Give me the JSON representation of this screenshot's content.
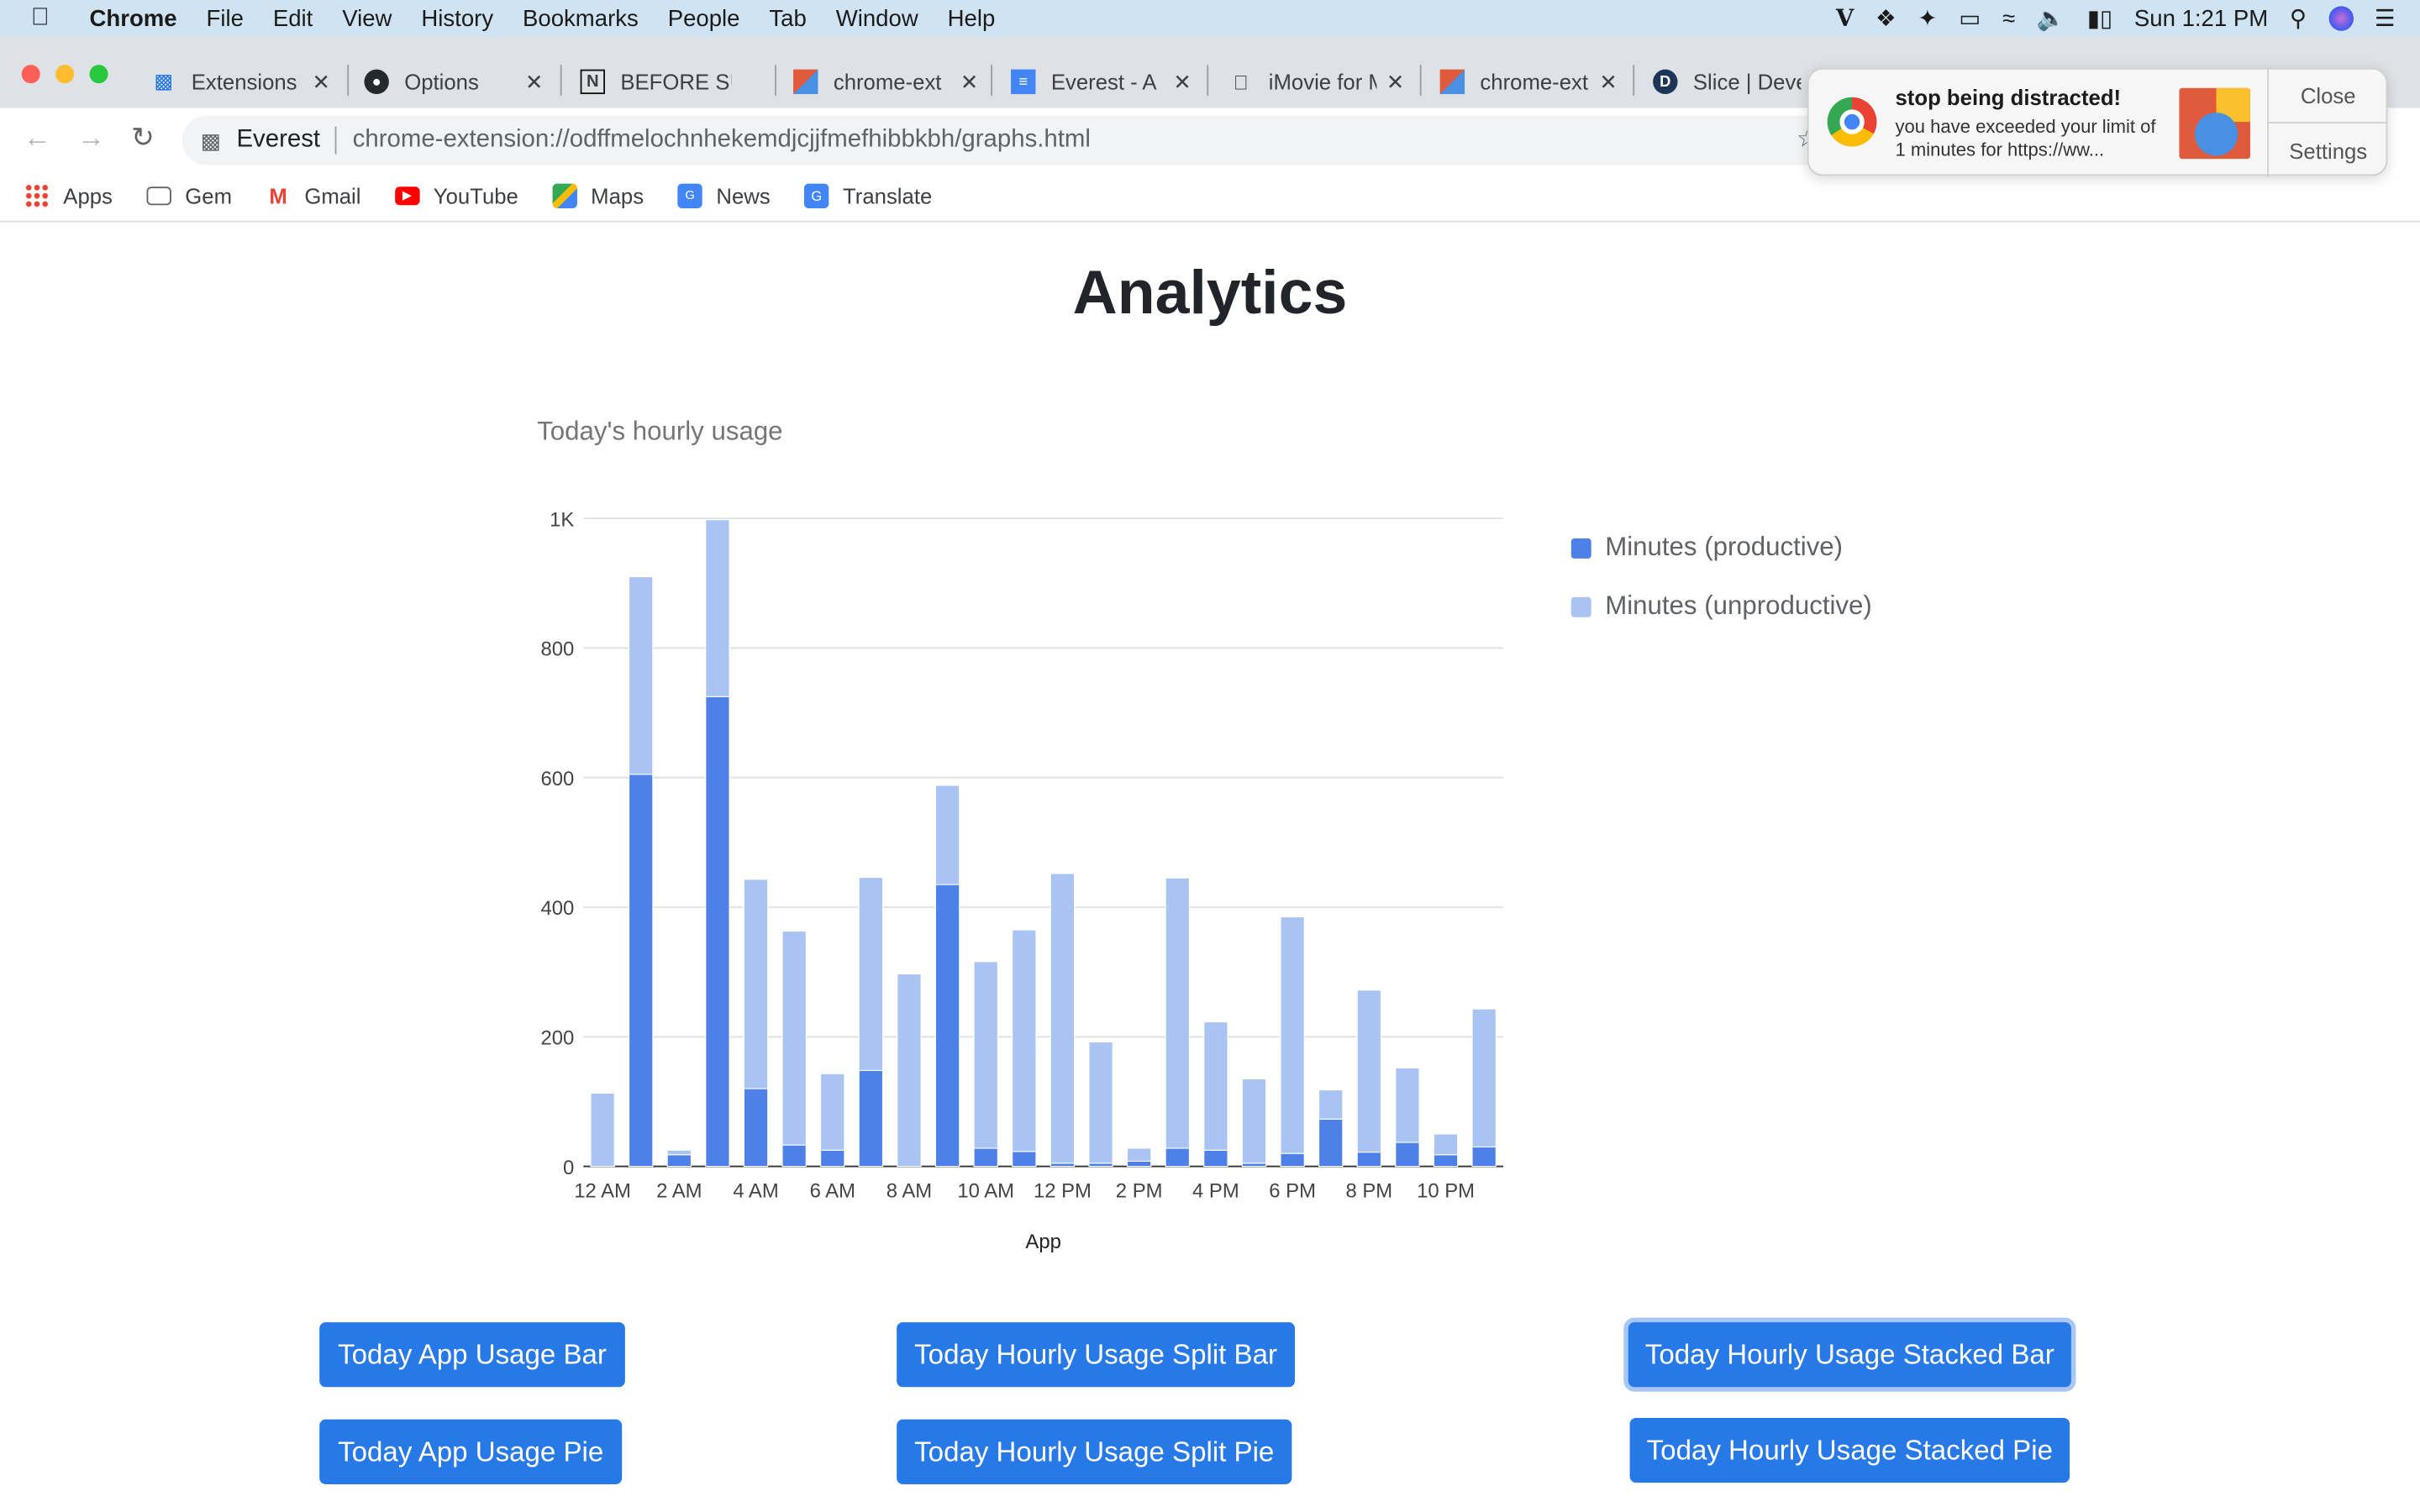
{
  "menubar": {
    "app": "Chrome",
    "items": [
      "File",
      "Edit",
      "View",
      "History",
      "Bookmarks",
      "People",
      "Tab",
      "Window",
      "Help"
    ],
    "clock": "Sun 1:21 PM"
  },
  "tabs": [
    {
      "label": "Extensions",
      "icon": "puzzle-icon"
    },
    {
      "label": "Options",
      "icon": "github-icon"
    },
    {
      "label": "BEFORE SU",
      "icon": "notion-icon"
    },
    {
      "label": "chrome-ext",
      "icon": "extension-tile-icon"
    },
    {
      "label": "Everest - A",
      "icon": "docs-icon"
    },
    {
      "label": "iMovie for M",
      "icon": "apple-icon"
    },
    {
      "label": "chrome-ext",
      "icon": "extension-tile-icon"
    },
    {
      "label": "Slice | Deve",
      "icon": "d-logo-icon"
    }
  ],
  "omnibox": {
    "site": "Everest",
    "url": "chrome-extension://odffmelochnhekemdjcjjfmefhibbkbh/graphs.html"
  },
  "bookmarks": [
    {
      "label": "Apps",
      "icon": "apps-grid-icon"
    },
    {
      "label": "Gem",
      "icon": "folder-icon"
    },
    {
      "label": "Gmail",
      "icon": "gmail-icon"
    },
    {
      "label": "YouTube",
      "icon": "youtube-icon"
    },
    {
      "label": "Maps",
      "icon": "maps-icon"
    },
    {
      "label": "News",
      "icon": "news-icon"
    },
    {
      "label": "Translate",
      "icon": "translate-icon"
    }
  ],
  "notification": {
    "title": "stop being distracted!",
    "body": "you have exceeded your limit of 1 minutes for https://ww...",
    "close_label": "Close",
    "settings_label": "Settings"
  },
  "page": {
    "title": "Analytics"
  },
  "chart_data": {
    "type": "bar",
    "stacked": true,
    "title": "Today's hourly usage",
    "xlabel": "App",
    "ylabel": "",
    "ylim": [
      0,
      1000
    ],
    "yticks": [
      0,
      200,
      400,
      600,
      800,
      1000
    ],
    "ytick_labels": [
      "0",
      "200",
      "400",
      "600",
      "800",
      "1K"
    ],
    "xtick_labels": [
      "12 AM",
      "2 AM",
      "4 AM",
      "6 AM",
      "8 AM",
      "10 AM",
      "12 PM",
      "2 PM",
      "4 PM",
      "6 PM",
      "8 PM",
      "10 PM"
    ],
    "categories": [
      "12 AM",
      "1 AM",
      "2 AM",
      "3 AM",
      "4 AM",
      "5 AM",
      "6 AM",
      "7 AM",
      "8 AM",
      "9 AM",
      "10 AM",
      "11 AM",
      "12 PM",
      "1 PM",
      "2 PM",
      "3 PM",
      "4 PM",
      "5 PM",
      "6 PM",
      "7 PM",
      "8 PM",
      "9 PM",
      "10 PM",
      "11 PM"
    ],
    "series": [
      {
        "name": "Minutes (productive)",
        "color": "#4e81e8",
        "values": [
          0,
          605,
          18,
          725,
          120,
          33,
          25,
          148,
          0,
          435,
          28,
          23,
          5,
          5,
          8,
          28,
          25,
          5,
          20,
          73,
          22,
          37,
          18,
          30
        ]
      },
      {
        "name": "Minutes (unproductive)",
        "color": "#a9c4f3",
        "values": [
          113,
          305,
          7,
          273,
          323,
          330,
          118,
          298,
          297,
          153,
          288,
          342,
          447,
          187,
          20,
          417,
          198,
          130,
          365,
          45,
          250,
          115,
          32,
          213
        ]
      }
    ],
    "legend_position": "right",
    "grid": true
  },
  "buttons": [
    {
      "label": "Today App Usage Bar"
    },
    {
      "label": "Today Hourly Usage Split Bar"
    },
    {
      "label": "Today Hourly Usage Stacked Bar"
    },
    {
      "label": "Today App Usage Pie"
    },
    {
      "label": "Today Hourly Usage Split Pie"
    },
    {
      "label": "Today Hourly Usage Stacked Pie"
    }
  ]
}
